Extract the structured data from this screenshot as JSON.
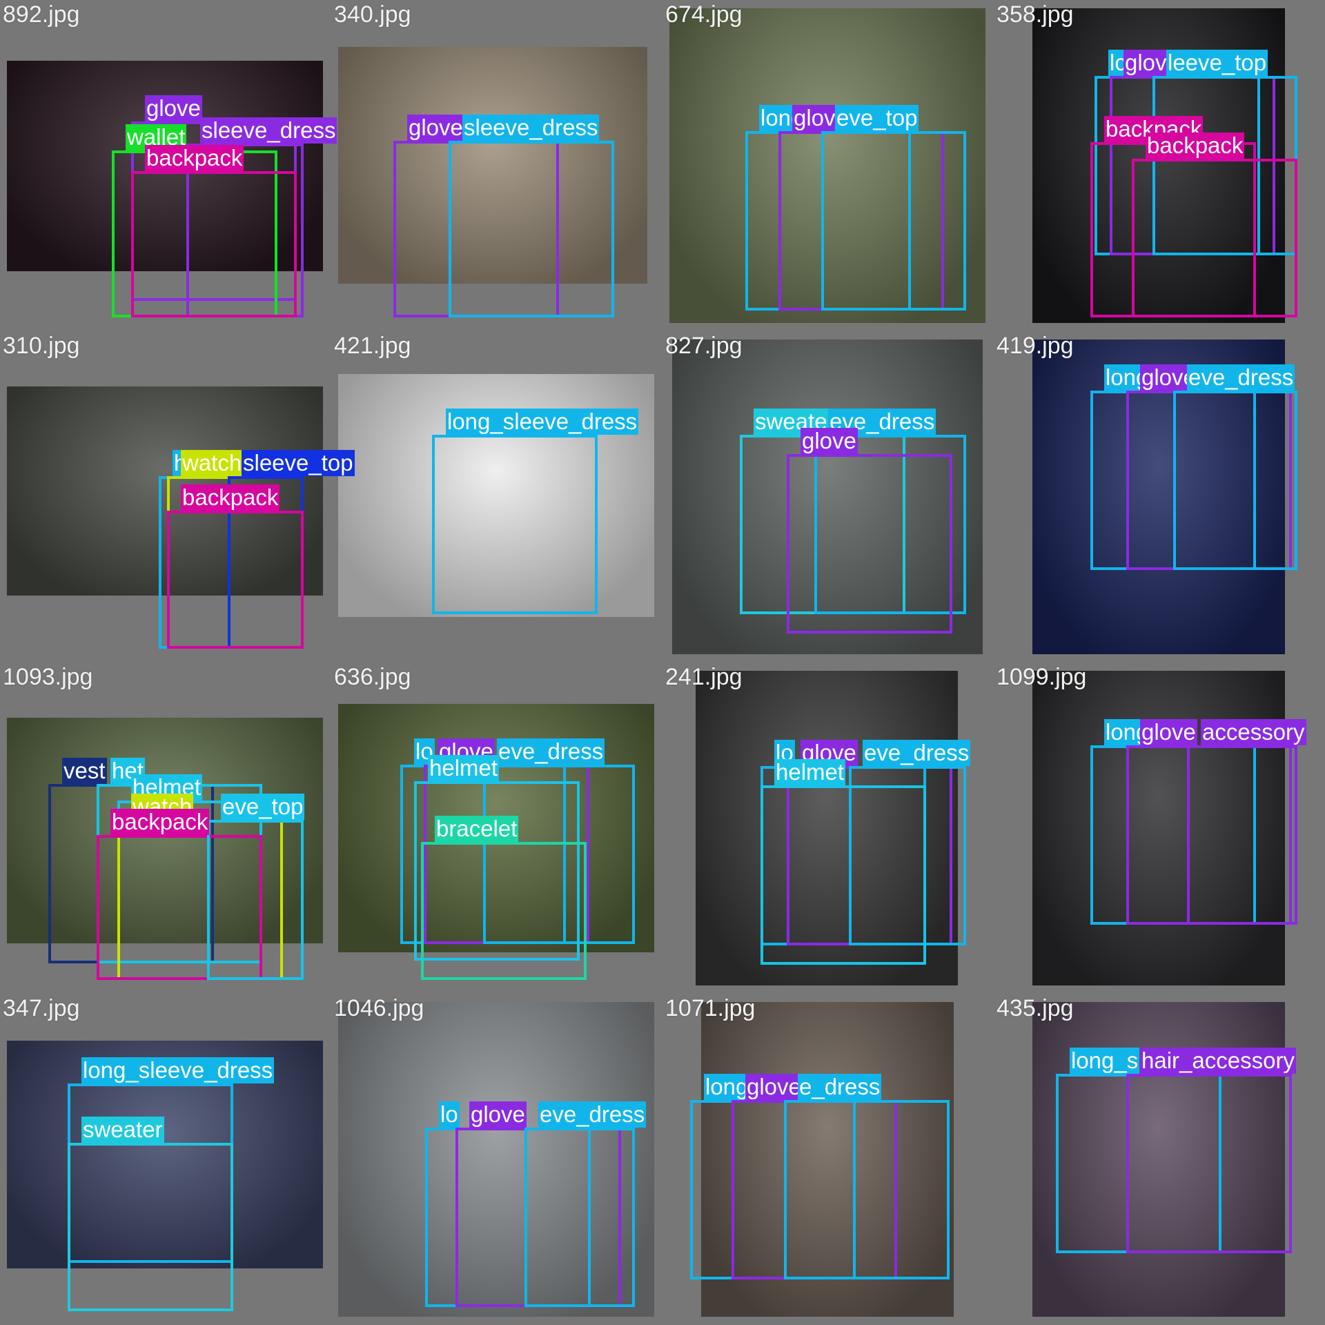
{
  "colors": {
    "long_sleeve": "#12b5ea",
    "glove": "#8a2be2",
    "backpack": "#d6069e",
    "wallet": "#16e02a",
    "watch": "#c8e300",
    "helmet": "#19c3e8",
    "vest": "#172f7a",
    "bracelet": "#1dd6a6",
    "sweater": "#1fc9dd",
    "hair_accessory": "#8a2be2",
    "blue_top": "#1231e0"
  },
  "tiles": [
    {
      "file": "892.jpg",
      "photo": "fashion-runway-dark",
      "tone": "#2a1a22",
      "detections": [
        {
          "label": "glove",
          "kind": "glove"
        },
        {
          "label": "wallet",
          "kind": "wallet"
        },
        {
          "label": "sleeve_dress",
          "kind": "glove"
        },
        {
          "label": "backpack",
          "kind": "backpack"
        }
      ]
    },
    {
      "file": "340.jpg",
      "photo": "woman-on-stone-steps",
      "tone": "#9a8c77",
      "detections": [
        {
          "label": "glove",
          "kind": "glove"
        },
        {
          "label": "sleeve_dress",
          "kind": "long_sleeve"
        }
      ]
    },
    {
      "file": "674.jpg",
      "photo": "woman-leaning-on-fence",
      "tone": "#6f7a56",
      "detections": [
        {
          "label": "long",
          "kind": "long_sleeve"
        },
        {
          "label": "glove",
          "kind": "glove"
        },
        {
          "label": "eve_top",
          "kind": "long_sleeve"
        }
      ]
    },
    {
      "file": "358.jpg",
      "photo": "runway-dark-curtain",
      "tone": "#1c1c1f",
      "detections": [
        {
          "label": "lc",
          "kind": "long_sleeve"
        },
        {
          "label": "glove",
          "kind": "glove"
        },
        {
          "label": "leeve_top",
          "kind": "long_sleeve"
        },
        {
          "label": "backpack",
          "kind": "backpack"
        },
        {
          "label": "backpack",
          "kind": "backpack"
        }
      ]
    },
    {
      "file": "310.jpg",
      "photo": "window-frame-terrace",
      "tone": "#4a4d46",
      "detections": [
        {
          "label": "h",
          "kind": "long_sleeve"
        },
        {
          "label": "watch",
          "kind": "watch"
        },
        {
          "label": "sleeve_top",
          "kind": "blue_top"
        },
        {
          "label": "backpack",
          "kind": "backpack"
        }
      ]
    },
    {
      "file": "421.jpg",
      "photo": "black-dress-studio",
      "tone": "#ececec",
      "detections": [
        {
          "label": "long_sleeve_dress",
          "kind": "long_sleeve"
        }
      ]
    },
    {
      "file": "827.jpg",
      "photo": "black-ruffle-dress-road",
      "tone": "#5d6360",
      "detections": [
        {
          "label": "sweater",
          "kind": "sweater"
        },
        {
          "label": "eve_dress",
          "kind": "long_sleeve"
        },
        {
          "label": "glove",
          "kind": "glove"
        }
      ]
    },
    {
      "file": "419.jpg",
      "photo": "runway-white-dress",
      "tone": "#1b2560",
      "detections": [
        {
          "label": "long",
          "kind": "long_sleeve"
        },
        {
          "label": "glove",
          "kind": "glove"
        },
        {
          "label": "eve_dress",
          "kind": "long_sleeve"
        }
      ]
    },
    {
      "file": "1093.jpg",
      "photo": "denim-jacket-garden",
      "tone": "#5b6b45",
      "detections": [
        {
          "label": "vest",
          "kind": "vest"
        },
        {
          "label": "het",
          "kind": "helmet"
        },
        {
          "label": "helmet",
          "kind": "helmet"
        },
        {
          "label": "watch",
          "kind": "watch"
        },
        {
          "label": "backpack",
          "kind": "backpack"
        },
        {
          "label": "eve_top",
          "kind": "helmet"
        }
      ]
    },
    {
      "file": "636.jpg",
      "photo": "rider-white-horse",
      "tone": "#5a6a3c",
      "detections": [
        {
          "label": "lo",
          "kind": "long_sleeve"
        },
        {
          "label": "glove",
          "kind": "glove"
        },
        {
          "label": "eve_dress",
          "kind": "long_sleeve"
        },
        {
          "label": "helmet",
          "kind": "helmet"
        },
        {
          "label": "bracelet",
          "kind": "bracelet"
        }
      ]
    },
    {
      "file": "241.jpg",
      "photo": "teal-dress-studio",
      "tone": "#3a3a3a",
      "detections": [
        {
          "label": "lo",
          "kind": "long_sleeve"
        },
        {
          "label": "glove",
          "kind": "glove"
        },
        {
          "label": "eve_dress",
          "kind": "long_sleeve"
        },
        {
          "label": "helmet",
          "kind": "helmet"
        }
      ]
    },
    {
      "file": "1099.jpg",
      "photo": "runway-strapless-gown",
      "tone": "#2c2b2e",
      "detections": [
        {
          "label": "long",
          "kind": "long_sleeve"
        },
        {
          "label": "glove",
          "kind": "glove"
        },
        {
          "label": "accessory",
          "kind": "glove"
        }
      ]
    },
    {
      "file": "347.jpg",
      "photo": "runway-bridal-gown",
      "tone": "#3b4366",
      "detections": [
        {
          "label": "long_sleeve_dress",
          "kind": "long_sleeve"
        },
        {
          "label": "sweater",
          "kind": "sweater"
        }
      ]
    },
    {
      "file": "1046.jpg",
      "photo": "floral-dress-street",
      "tone": "#8a8e91",
      "detections": [
        {
          "label": "lo",
          "kind": "long_sleeve"
        },
        {
          "label": "glove",
          "kind": "glove"
        },
        {
          "label": "eve_dress",
          "kind": "long_sleeve"
        }
      ]
    },
    {
      "file": "1071.jpg",
      "photo": "woman-on-rocks",
      "tone": "#6a5e54",
      "detections": [
        {
          "label": "long",
          "kind": "long_sleeve"
        },
        {
          "label": "glove",
          "kind": "glove"
        },
        {
          "label": "e_dress",
          "kind": "long_sleeve"
        }
      ]
    },
    {
      "file": "435.jpg",
      "photo": "runway-lavender-gown",
      "tone": "#5a4a5e",
      "detections": [
        {
          "label": "long_s",
          "kind": "long_sleeve"
        },
        {
          "label": "hair_accessory",
          "kind": "hair_accessory"
        }
      ]
    }
  ]
}
